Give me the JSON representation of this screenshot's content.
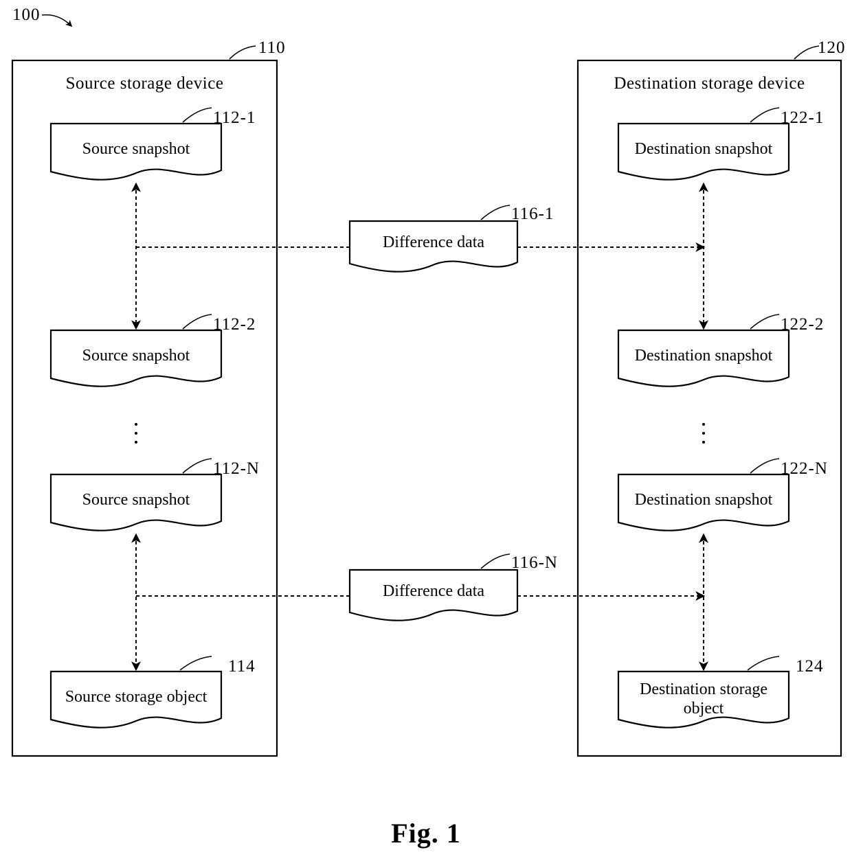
{
  "figure": {
    "caption": "Fig. 1",
    "system_ref": "100"
  },
  "containers": [
    {
      "name": "source-storage-device",
      "title": "Source storage device",
      "ref": "110"
    },
    {
      "name": "destination-storage-device",
      "title": "Destination storage device",
      "ref": "120"
    }
  ],
  "source": {
    "title": "Source storage device",
    "ref": "110",
    "snapshots": [
      {
        "label": "Source snapshot",
        "ref": "112-1"
      },
      {
        "label": "Source snapshot",
        "ref": "112-2"
      },
      {
        "label": "Source snapshot",
        "ref": "112-N"
      }
    ],
    "storage_object": {
      "label": "Source storage object",
      "ref": "114"
    },
    "ellipsis": "⋮"
  },
  "destination": {
    "title": "Destination storage device",
    "ref": "120",
    "snapshots": [
      {
        "label": "Destination snapshot",
        "ref": "122-1"
      },
      {
        "label": "Destination snapshot",
        "ref": "122-2"
      },
      {
        "label": "Destination snapshot",
        "ref": "122-N"
      }
    ],
    "storage_object": {
      "label_line1": "Destination storage",
      "label_line2": "object",
      "ref": "124"
    },
    "ellipsis": "⋮"
  },
  "difference_data": [
    {
      "label": "Difference data",
      "ref": "116-1"
    },
    {
      "label": "Difference data",
      "ref": "116-N"
    }
  ],
  "colors": {
    "stroke": "#000000",
    "background": "#ffffff"
  }
}
